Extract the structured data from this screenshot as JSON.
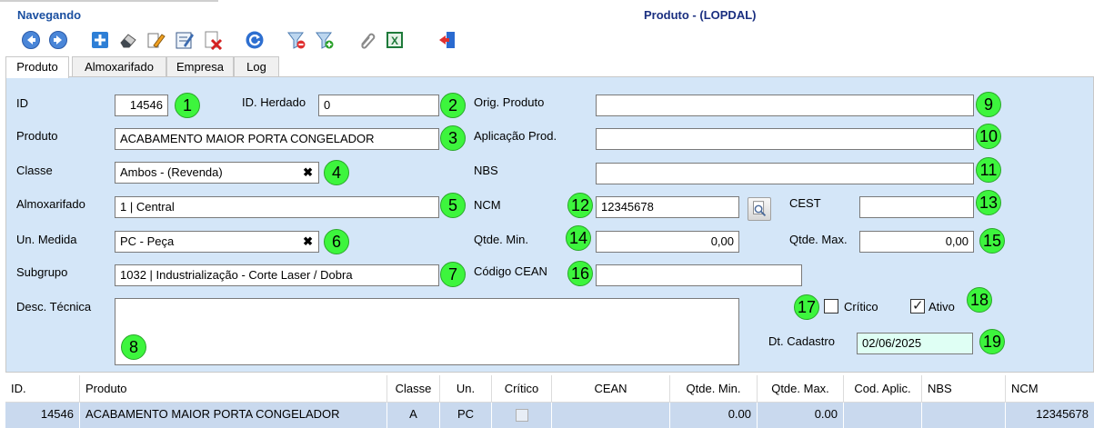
{
  "window": {
    "nav_label": "Navegando",
    "title": "Produto - (LOPDAL)"
  },
  "toolbar": [
    {
      "name": "back-icon"
    },
    {
      "name": "forward-icon"
    },
    {
      "name": "add-icon"
    },
    {
      "name": "eraser-icon"
    },
    {
      "name": "edit-pencil-icon"
    },
    {
      "name": "edit-form-icon"
    },
    {
      "name": "delete-icon"
    },
    {
      "name": "refresh-icon"
    },
    {
      "name": "filter-remove-icon"
    },
    {
      "name": "filter-add-icon"
    },
    {
      "name": "attach-icon"
    },
    {
      "name": "excel-icon"
    },
    {
      "name": "exit-icon"
    }
  ],
  "tabs": [
    "Produto",
    "Almoxarifado",
    "Empresa",
    "Log"
  ],
  "form": {
    "id_label": "ID",
    "id_value": "14546",
    "herdado_label": "ID. Herdado",
    "herdado_value": "0",
    "produto_label": "Produto",
    "produto_value": "ACABAMENTO MAIOR PORTA CONGELADOR",
    "classe_label": "Classe",
    "classe_value": "Ambos - (Revenda)",
    "almox_label": "Almoxarifado",
    "almox_value": "1 | Central",
    "unmed_label": "Un. Medida",
    "unmed_value": "PC - Peça",
    "subgrupo_label": "Subgrupo",
    "subgrupo_value": "1032 | Industrialização - Corte Laser / Dobra",
    "desc_label": "Desc. Técnica",
    "desc_value": "",
    "orig_label": "Orig. Produto",
    "orig_value": "",
    "aplic_label": "Aplicação Prod.",
    "aplic_value": "",
    "nbs_label": "NBS",
    "nbs_value": "",
    "ncm_label": "NCM",
    "ncm_value": "12345678",
    "cest_label": "CEST",
    "cest_value": "",
    "qmin_label": "Qtde. Min.",
    "qmin_value": "0,00",
    "qmax_label": "Qtde. Max.",
    "qmax_value": "0,00",
    "cean_label": "Código CEAN",
    "cean_value": "",
    "critico_label": "Crítico",
    "critico_checked": false,
    "ativo_label": "Ativo",
    "ativo_checked": true,
    "dtcad_label": "Dt. Cadastro",
    "dtcad_value": "02/06/2025",
    "clear_glyph": "✖"
  },
  "badges": [
    "1",
    "2",
    "3",
    "4",
    "5",
    "6",
    "7",
    "8",
    "9",
    "10",
    "11",
    "12",
    "13",
    "14",
    "15",
    "16",
    "17",
    "18",
    "19"
  ],
  "grid": {
    "headers": [
      "ID.",
      "Produto",
      "Classe",
      "Un.",
      "Crítico",
      "CEAN",
      "Qtde. Min.",
      "Qtde. Max.",
      "Cod. Aplic.",
      "NBS",
      "NCM"
    ],
    "rows": [
      [
        "14546",
        "ACABAMENTO MAIOR PORTA CONGELADOR",
        "A",
        "PC",
        "",
        "",
        "0.00",
        "0.00",
        "",
        "",
        "12345678"
      ]
    ]
  },
  "colors": {
    "panel": "#d4e6f8",
    "badge": "#3df53d",
    "selected_row": "#c9d9ee",
    "title": "#1a2f80"
  }
}
